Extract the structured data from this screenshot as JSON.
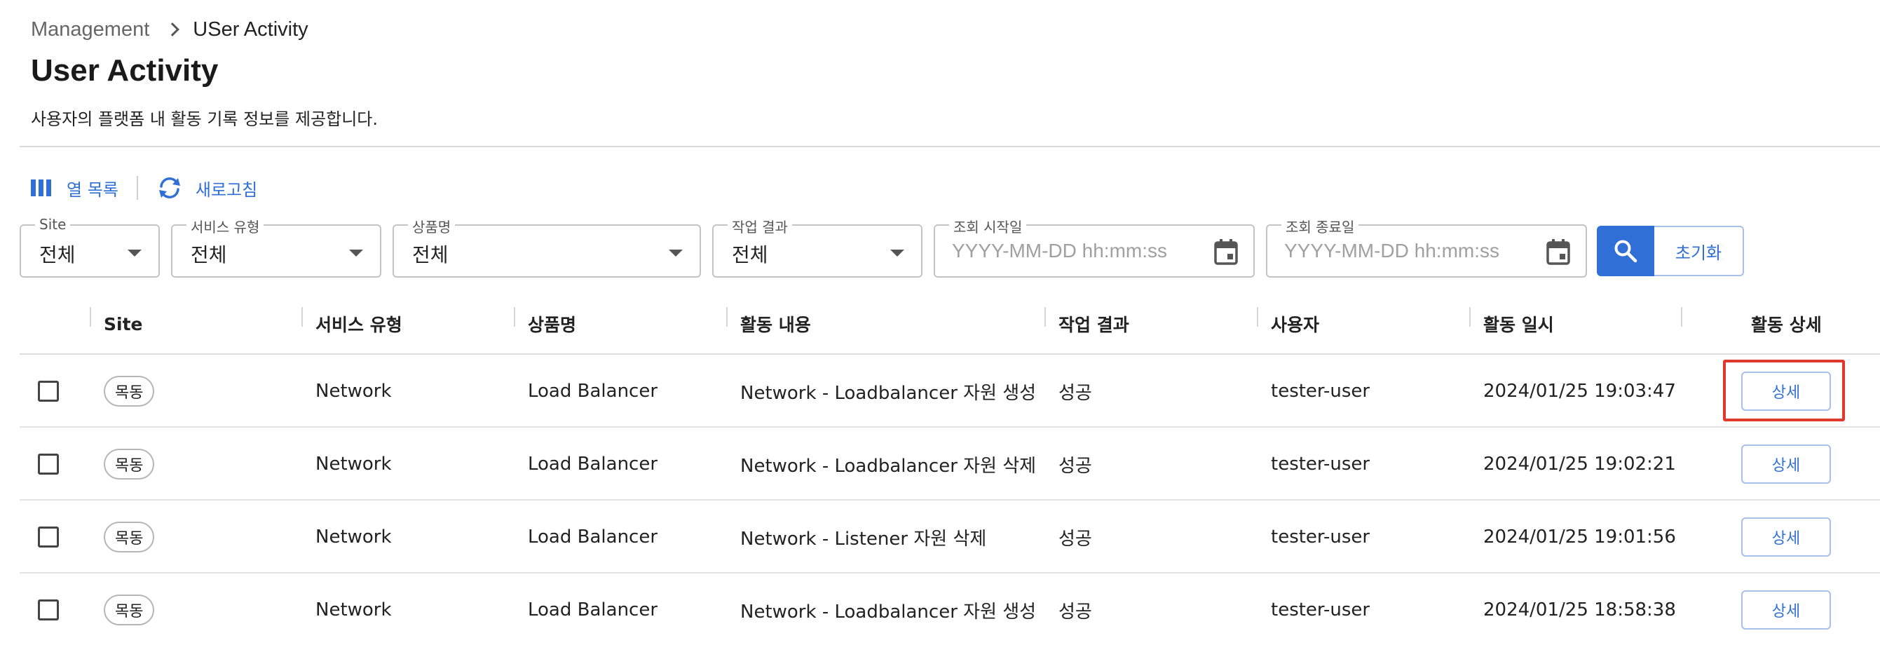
{
  "breadcrumb": {
    "parent": "Management",
    "current": "USer Activity"
  },
  "page": {
    "title": "User Activity",
    "description": "사용자의 플랫폼 내 활동 기록 정보를 제공합니다."
  },
  "toolbar": {
    "columns_label": "열 목록",
    "refresh_label": "새로고침"
  },
  "filters": {
    "site": {
      "label": "Site",
      "value": "전체"
    },
    "service_type": {
      "label": "서비스 유형",
      "value": "전체"
    },
    "product": {
      "label": "상품명",
      "value": "전체"
    },
    "result": {
      "label": "작업 결과",
      "value": "전체"
    },
    "start_date": {
      "label": "조회 시작일",
      "placeholder": "YYYY-MM-DD hh:mm:ss"
    },
    "end_date": {
      "label": "조회 종료일",
      "placeholder": "YYYY-MM-DD hh:mm:ss"
    },
    "reset_label": "초기화"
  },
  "table": {
    "headers": {
      "site": "Site",
      "service_type": "서비스 유형",
      "product": "상품명",
      "activity": "활동 내용",
      "result": "작업 결과",
      "user": "사용자",
      "datetime": "활동 일시",
      "detail": "활동 상세"
    },
    "rows": [
      {
        "site": "목동",
        "service_type": "Network",
        "product": "Load Balancer",
        "activity": "Network - Loadbalancer 자원 생성",
        "result": "성공",
        "user": "tester-user",
        "datetime": "2024/01/25 19:03:47",
        "detail": "상세"
      },
      {
        "site": "목동",
        "service_type": "Network",
        "product": "Load Balancer",
        "activity": "Network - Loadbalancer 자원 삭제",
        "result": "성공",
        "user": "tester-user",
        "datetime": "2024/01/25 19:02:21",
        "detail": "상세"
      },
      {
        "site": "목동",
        "service_type": "Network",
        "product": "Load Balancer",
        "activity": "Network - Listener 자원 삭제",
        "result": "성공",
        "user": "tester-user",
        "datetime": "2024/01/25 19:01:56",
        "detail": "상세"
      },
      {
        "site": "목동",
        "service_type": "Network",
        "product": "Load Balancer",
        "activity": "Network - Loadbalancer 자원 생성",
        "result": "성공",
        "user": "tester-user",
        "datetime": "2024/01/25 18:58:38",
        "detail": "상세"
      }
    ]
  },
  "colors": {
    "accent": "#2f6fd6",
    "highlight": "#e0392b"
  },
  "icons": {
    "columns": "columns-icon",
    "refresh": "refresh-icon",
    "calendar": "calendar-icon",
    "search": "search-icon",
    "chevron": "chevron-right-icon",
    "caret": "caret-down-icon"
  }
}
